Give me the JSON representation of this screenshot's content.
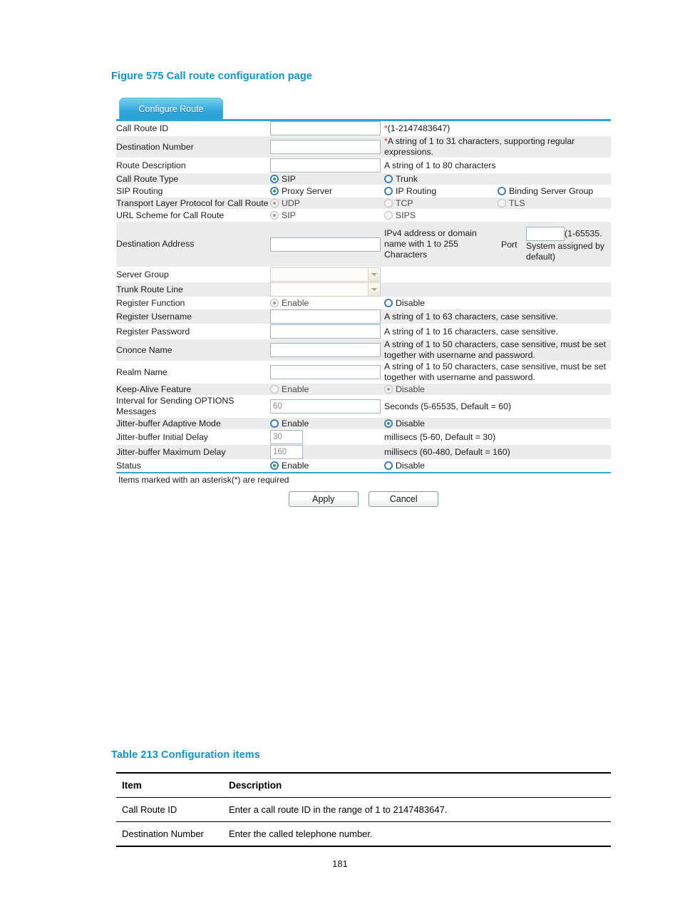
{
  "figure": {
    "caption": "Figure 575 Call route configuration page"
  },
  "panel": {
    "tab_label": "Configure Route",
    "required_note": "Items marked with an asterisk(*) are required",
    "apply_label": "Apply",
    "cancel_label": "Cancel"
  },
  "colors": {
    "accent_blue": "#2ba6dd",
    "caption_blue": "#0d94d6",
    "required_red": "#e8231a",
    "radio_ring": "#3d7fba",
    "radio_dot": "#33a02c",
    "row_gray": "#ebebeb"
  },
  "form": {
    "rows": [
      {
        "label": "Call Route ID",
        "input_value": "",
        "hint_star": "*",
        "hint": "(1-2147483647)"
      },
      {
        "label": "Destination Number",
        "input_value": "",
        "hint_star": "*",
        "hint": "A string of 1 to 31 characters, supporting regular expressions."
      },
      {
        "label": "Route Description",
        "input_value": "",
        "hint": "A string of 1 to 80 characters"
      },
      {
        "label": "Call Route Type",
        "options": [
          {
            "label": "SIP",
            "selected": true
          },
          {
            "label": "Trunk",
            "selected": false
          }
        ]
      },
      {
        "label": "SIP Routing",
        "options": [
          {
            "label": "Proxy Server",
            "selected": true
          },
          {
            "label": "IP Routing",
            "selected": false
          },
          {
            "label": "Binding Server Group",
            "selected": false
          }
        ]
      },
      {
        "label": "Transport Layer Protocol for Call Route",
        "disabled": true,
        "options": [
          {
            "label": "UDP",
            "selected": true
          },
          {
            "label": "TCP",
            "selected": false
          },
          {
            "label": "TLS",
            "selected": false
          }
        ]
      },
      {
        "label": "URL Scheme for Call Route",
        "disabled": true,
        "options": [
          {
            "label": "SIP",
            "selected": true
          },
          {
            "label": "SIPS",
            "selected": false
          }
        ]
      },
      {
        "label": "Destination Address",
        "input_value": "",
        "hint": "IPv4 address or domain name with 1 to 255 Characters",
        "port_label": "Port",
        "port_value": "",
        "port_hint": "(1-65535. System assigned by default)"
      },
      {
        "label": "Server Group",
        "select_value": ""
      },
      {
        "label": "Trunk Route Line",
        "select_value": ""
      },
      {
        "label": "Register Function",
        "disabled": true,
        "options": [
          {
            "label": "Enable",
            "selected": true
          },
          {
            "label": "Disable",
            "selected": false
          }
        ]
      },
      {
        "label": "Register Username",
        "input_value": "",
        "hint": "A string of 1 to 63 characters, case sensitive."
      },
      {
        "label": "Register Password",
        "input_value": "",
        "hint": "A string of 1 to 16 characters, case sensitive."
      },
      {
        "label": "Cnonce Name",
        "input_value": "",
        "hint": "A string of 1 to 50 characters, case sensitive, must be set together with username and password."
      },
      {
        "label": "Realm Name",
        "input_value": "",
        "hint": "A string of 1 to 50 characters, case sensitive, must be set together with username and password."
      },
      {
        "label": "Keep-Alive Feature",
        "disabled": true,
        "options": [
          {
            "label": "Enable",
            "selected": false
          },
          {
            "label": "Disable",
            "selected": true
          }
        ]
      },
      {
        "label": "Interval for Sending OPTIONS Messages",
        "input_value": "60",
        "hint": "Seconds (5-65535, Default = 60)"
      },
      {
        "label": "Jitter-buffer Adaptive Mode",
        "options": [
          {
            "label": "Enable",
            "selected": false
          },
          {
            "label": "Disable",
            "selected": true
          }
        ]
      },
      {
        "label": "Jitter-buffer Initial Delay",
        "input_value": "30",
        "hint": "millisecs (5-60, Default = 30)"
      },
      {
        "label": "Jitter-buffer Maximum Delay",
        "input_value": "160",
        "hint": "millisecs (60-480, Default = 160)"
      },
      {
        "label": "Status",
        "options": [
          {
            "label": "Enable",
            "selected": true
          },
          {
            "label": "Disable",
            "selected": false
          }
        ]
      }
    ]
  },
  "table213": {
    "caption": "Table 213 Configuration items",
    "headers": [
      "Item",
      "Description"
    ],
    "rows": [
      {
        "item": "Call Route ID",
        "description": "Enter a call route ID in the range of 1 to 2147483647."
      },
      {
        "item": "Destination Number",
        "description": "Enter the called telephone number."
      }
    ]
  },
  "page_number": "181"
}
